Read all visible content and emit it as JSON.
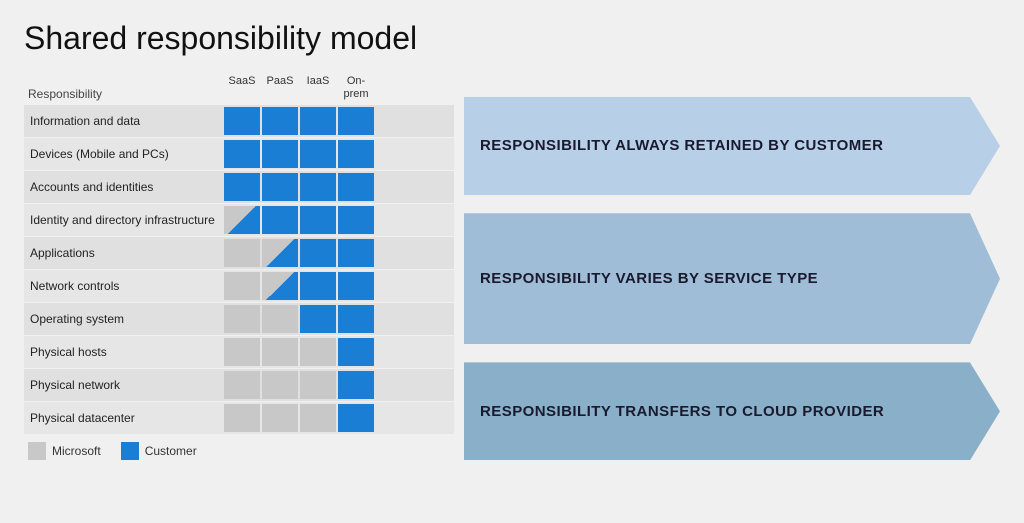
{
  "title": "Shared responsibility model",
  "table": {
    "col_header_label": "Responsibility",
    "columns": [
      {
        "id": "saas",
        "label": "SaaS"
      },
      {
        "id": "paas",
        "label": "PaaS"
      },
      {
        "id": "iaas",
        "label": "IaaS"
      },
      {
        "id": "onprem",
        "label": "On-\nprem"
      }
    ],
    "rows": [
      {
        "label": "Information and data",
        "cells": [
          "blue",
          "blue",
          "blue",
          "blue"
        ]
      },
      {
        "label": "Devices (Mobile and PCs)",
        "cells": [
          "blue",
          "blue",
          "blue",
          "blue"
        ]
      },
      {
        "label": "Accounts and identities",
        "cells": [
          "blue",
          "blue",
          "blue",
          "blue"
        ]
      },
      {
        "label": "Identity and directory infrastructure",
        "cells": [
          "split",
          "blue",
          "blue",
          "blue"
        ]
      },
      {
        "label": "Applications",
        "cells": [
          "gray",
          "split",
          "blue",
          "blue"
        ]
      },
      {
        "label": "Network controls",
        "cells": [
          "gray",
          "split",
          "blue",
          "blue"
        ]
      },
      {
        "label": "Operating system",
        "cells": [
          "gray",
          "gray",
          "blue",
          "blue"
        ]
      },
      {
        "label": "Physical hosts",
        "cells": [
          "gray",
          "gray",
          "gray",
          "blue"
        ]
      },
      {
        "label": "Physical network",
        "cells": [
          "gray",
          "gray",
          "gray",
          "blue"
        ]
      },
      {
        "label": "Physical datacenter",
        "cells": [
          "gray",
          "gray",
          "gray",
          "blue"
        ]
      }
    ]
  },
  "banners": [
    {
      "id": "customer",
      "text": "RESPONSIBILITY ALWAYS RETAINED BY CUSTOMER",
      "rows": 3
    },
    {
      "id": "varies",
      "text": "RESPONSIBILITY VARIES BY SERVICE TYPE",
      "rows": 4
    },
    {
      "id": "provider",
      "text": "RESPONSIBILITY TRANSFERS TO CLOUD PROVIDER",
      "rows": 3
    }
  ],
  "legend": {
    "items": [
      {
        "id": "microsoft",
        "color": "gray",
        "label": "Microsoft"
      },
      {
        "id": "customer",
        "color": "blue",
        "label": "Customer"
      }
    ]
  }
}
